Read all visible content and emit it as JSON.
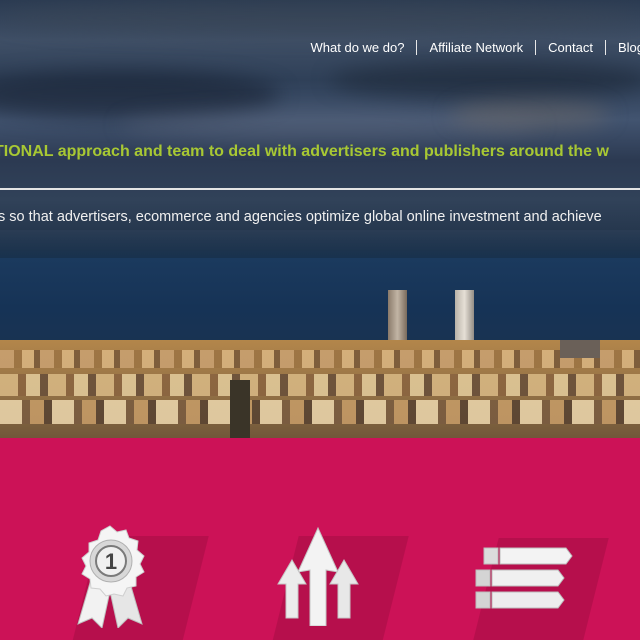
{
  "nav": {
    "items": [
      {
        "label": "What do we do?"
      },
      {
        "label": "Affiliate Network"
      },
      {
        "label": "Contact"
      },
      {
        "label": "Blog"
      }
    ]
  },
  "hero": {
    "tagline": "TIONAL approach and team to deal with advertisers and publishers around the w",
    "subline": "s so that advertisers, ecommerce and agencies optimize global online investment and achieve"
  },
  "features": {
    "award_digit": "1",
    "icons": [
      "award-ribbon-icon",
      "arrows-up-icon",
      "list-bars-icon"
    ]
  },
  "colors": {
    "tagline": "#a8c833",
    "panel": "#cc1257",
    "nav_text": "#ffffff"
  }
}
